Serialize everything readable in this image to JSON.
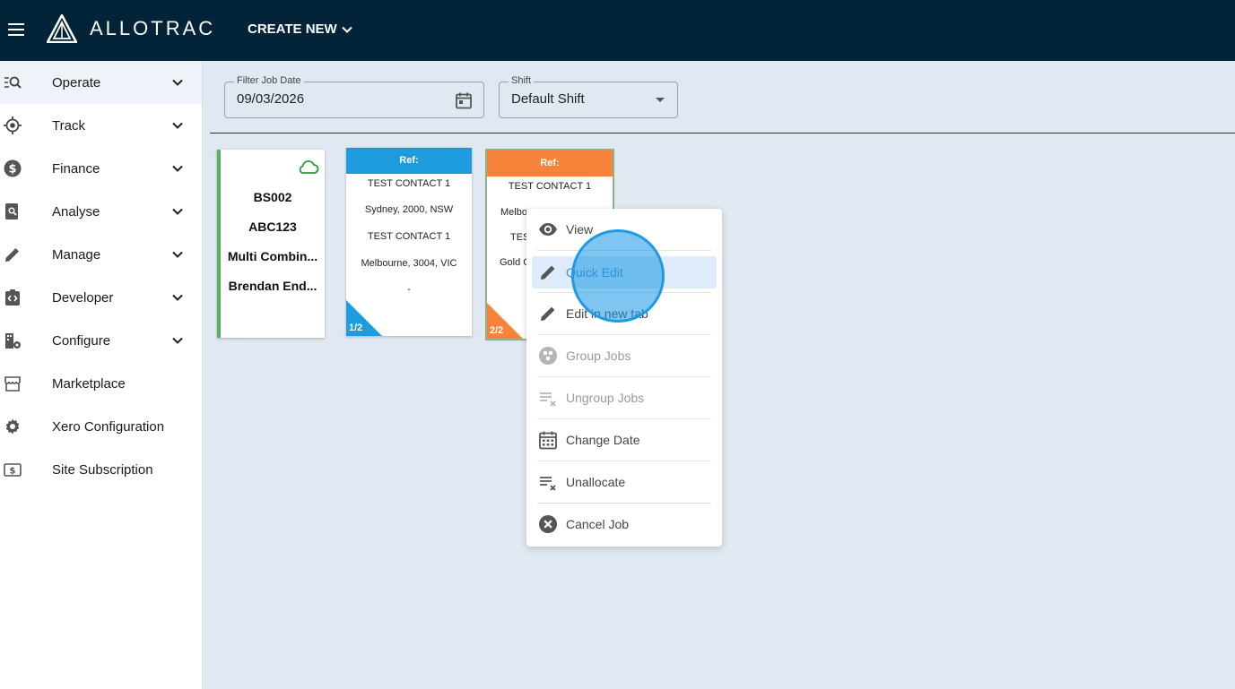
{
  "app": {
    "brand": "ALLOTRAC",
    "create_new": "CREATE NEW"
  },
  "sidebar": {
    "items": [
      {
        "label": "Operate",
        "icon": "operate-search-list-icon",
        "expandable": true
      },
      {
        "label": "Track",
        "icon": "location-target-icon",
        "expandable": true
      },
      {
        "label": "Finance",
        "icon": "dollar-circle-icon",
        "expandable": true
      },
      {
        "label": "Analyse",
        "icon": "report-search-icon",
        "expandable": true
      },
      {
        "label": "Manage",
        "icon": "pencil-icon",
        "expandable": true
      },
      {
        "label": "Developer",
        "icon": "code-clipboard-icon",
        "expandable": true
      },
      {
        "label": "Configure",
        "icon": "building-gear-icon",
        "expandable": true
      },
      {
        "label": "Marketplace",
        "icon": "storefront-icon",
        "expandable": false
      },
      {
        "label": "Xero Configuration",
        "icon": "gear-icon",
        "expandable": false
      },
      {
        "label": "Site Subscription",
        "icon": "dollar-bill-icon",
        "expandable": false
      }
    ]
  },
  "filters": {
    "date_label": "Filter Job Date",
    "date_value": "09/03/2026",
    "shift_label": "Shift",
    "shift_value": "Default Shift"
  },
  "vehicle_card": {
    "lines": [
      "BS002",
      "ABC123",
      "Multi Combin...",
      "Brendan End..."
    ],
    "status_color": "#58b35e"
  },
  "job_cards": [
    {
      "ref": "Ref:",
      "lines": [
        "TEST CONTACT 1",
        "Sydney, 2000, NSW",
        "TEST CONTACT 1",
        "Melbourne, 3004, VIC",
        "-"
      ],
      "position": "1/2",
      "color": "#1e9ade"
    },
    {
      "ref": "Ref:",
      "lines": [
        "TEST CONTACT 1",
        "Melbo",
        "TES",
        "Gold C"
      ],
      "position": "2/2",
      "color": "#f7823a"
    }
  ],
  "context_menu": {
    "items": [
      {
        "label": "View",
        "icon": "eye-icon",
        "disabled": false
      },
      {
        "label": "Quick Edit",
        "icon": "pencil-icon",
        "disabled": false,
        "highlighted": true
      },
      {
        "label": "Edit in new tab",
        "icon": "pencil-icon",
        "disabled": false
      },
      {
        "label": "Group Jobs",
        "icon": "group-circles-icon",
        "disabled": true
      },
      {
        "label": "Ungroup Jobs",
        "icon": "list-remove-icon",
        "disabled": true
      },
      {
        "label": "Change Date",
        "icon": "calendar-icon",
        "disabled": false
      },
      {
        "label": "Unallocate",
        "icon": "list-remove-icon",
        "disabled": false
      },
      {
        "label": "Cancel Job",
        "icon": "cancel-circle-icon",
        "disabled": false
      }
    ]
  },
  "colors": {
    "topbar": "#022338",
    "background": "#e0e8f2",
    "accent_blue": "#1e9ade",
    "accent_orange": "#f7823a",
    "active_green": "#58b35e"
  }
}
